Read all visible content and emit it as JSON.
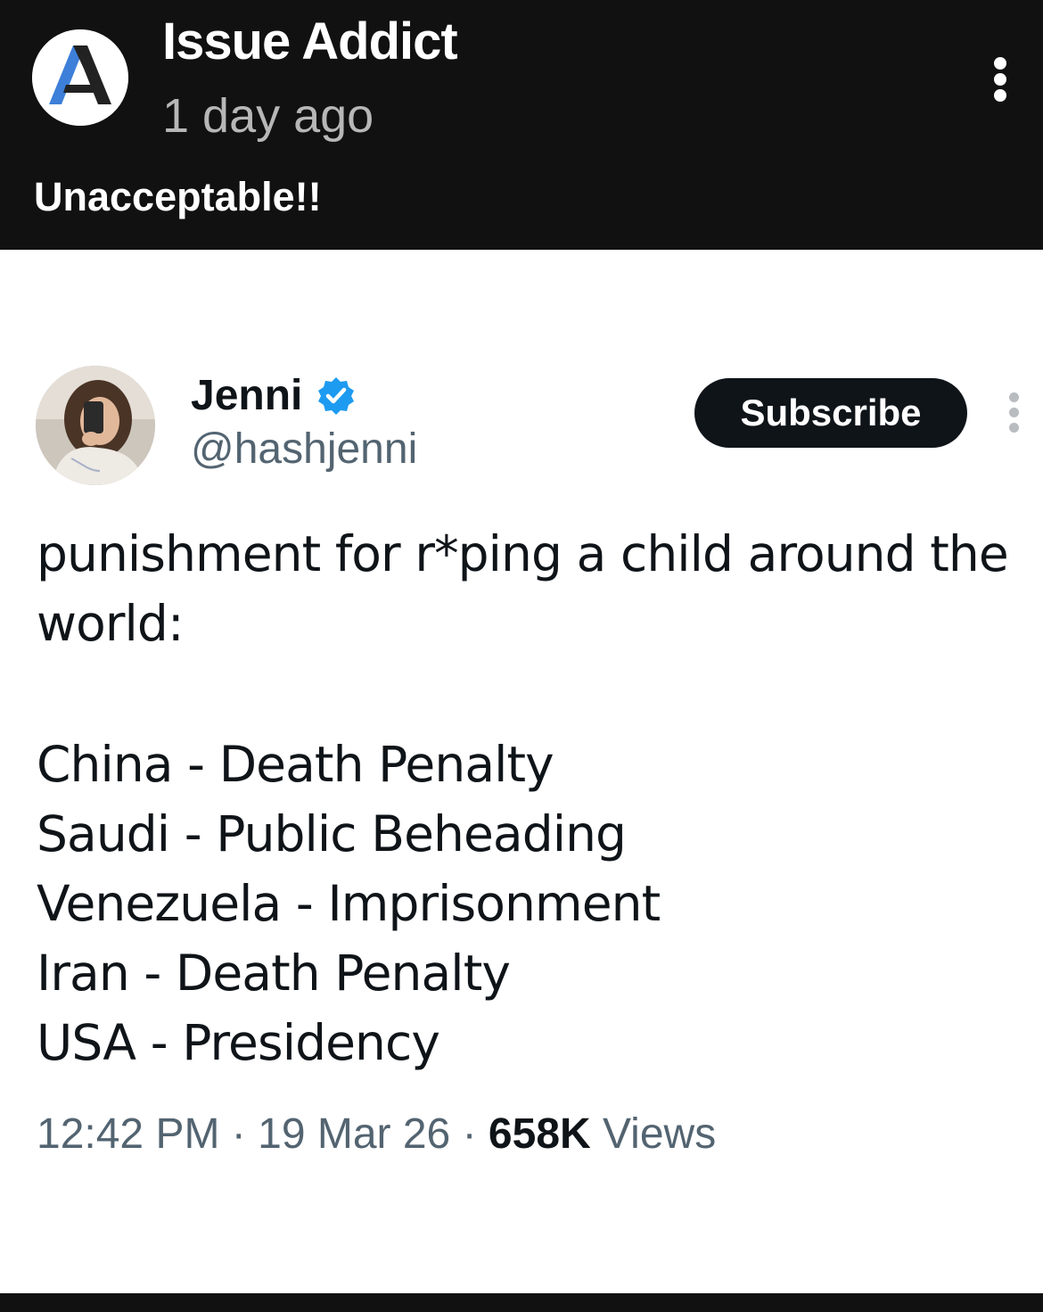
{
  "post": {
    "channel_name": "Issue Addict",
    "channel_avatar_letter": "A",
    "time": "1 day ago",
    "caption": "Unacceptable!!",
    "menu_icon": "more-vertical-icon",
    "colors": {
      "background": "#111111",
      "text": "#ffffff",
      "muted": "#b7b7b7",
      "logo_blue": "#3d7fd9"
    }
  },
  "tweet": {
    "name": "Jenni",
    "verified_icon": "verified-badge-icon",
    "handle": "@hashjenni",
    "subscribe_label": "Subscribe",
    "menu_icon": "more-vertical-icon",
    "intro_line": "punishment for r*ping a child around the world:",
    "list_lines": [
      "China - Death Penalty",
      "Saudi - Public Beheading",
      "Venezuela - Imprisonment",
      "Iran - Death Penalty",
      "USA - Presidency"
    ],
    "time": "12:42 PM",
    "date": "19 Mar 26",
    "separator": "·",
    "views_count": "658K",
    "views_label": "Views",
    "colors": {
      "text": "#0f1419",
      "muted": "#536471",
      "verified": "#1d9bf0",
      "button": "#0f1419"
    }
  }
}
